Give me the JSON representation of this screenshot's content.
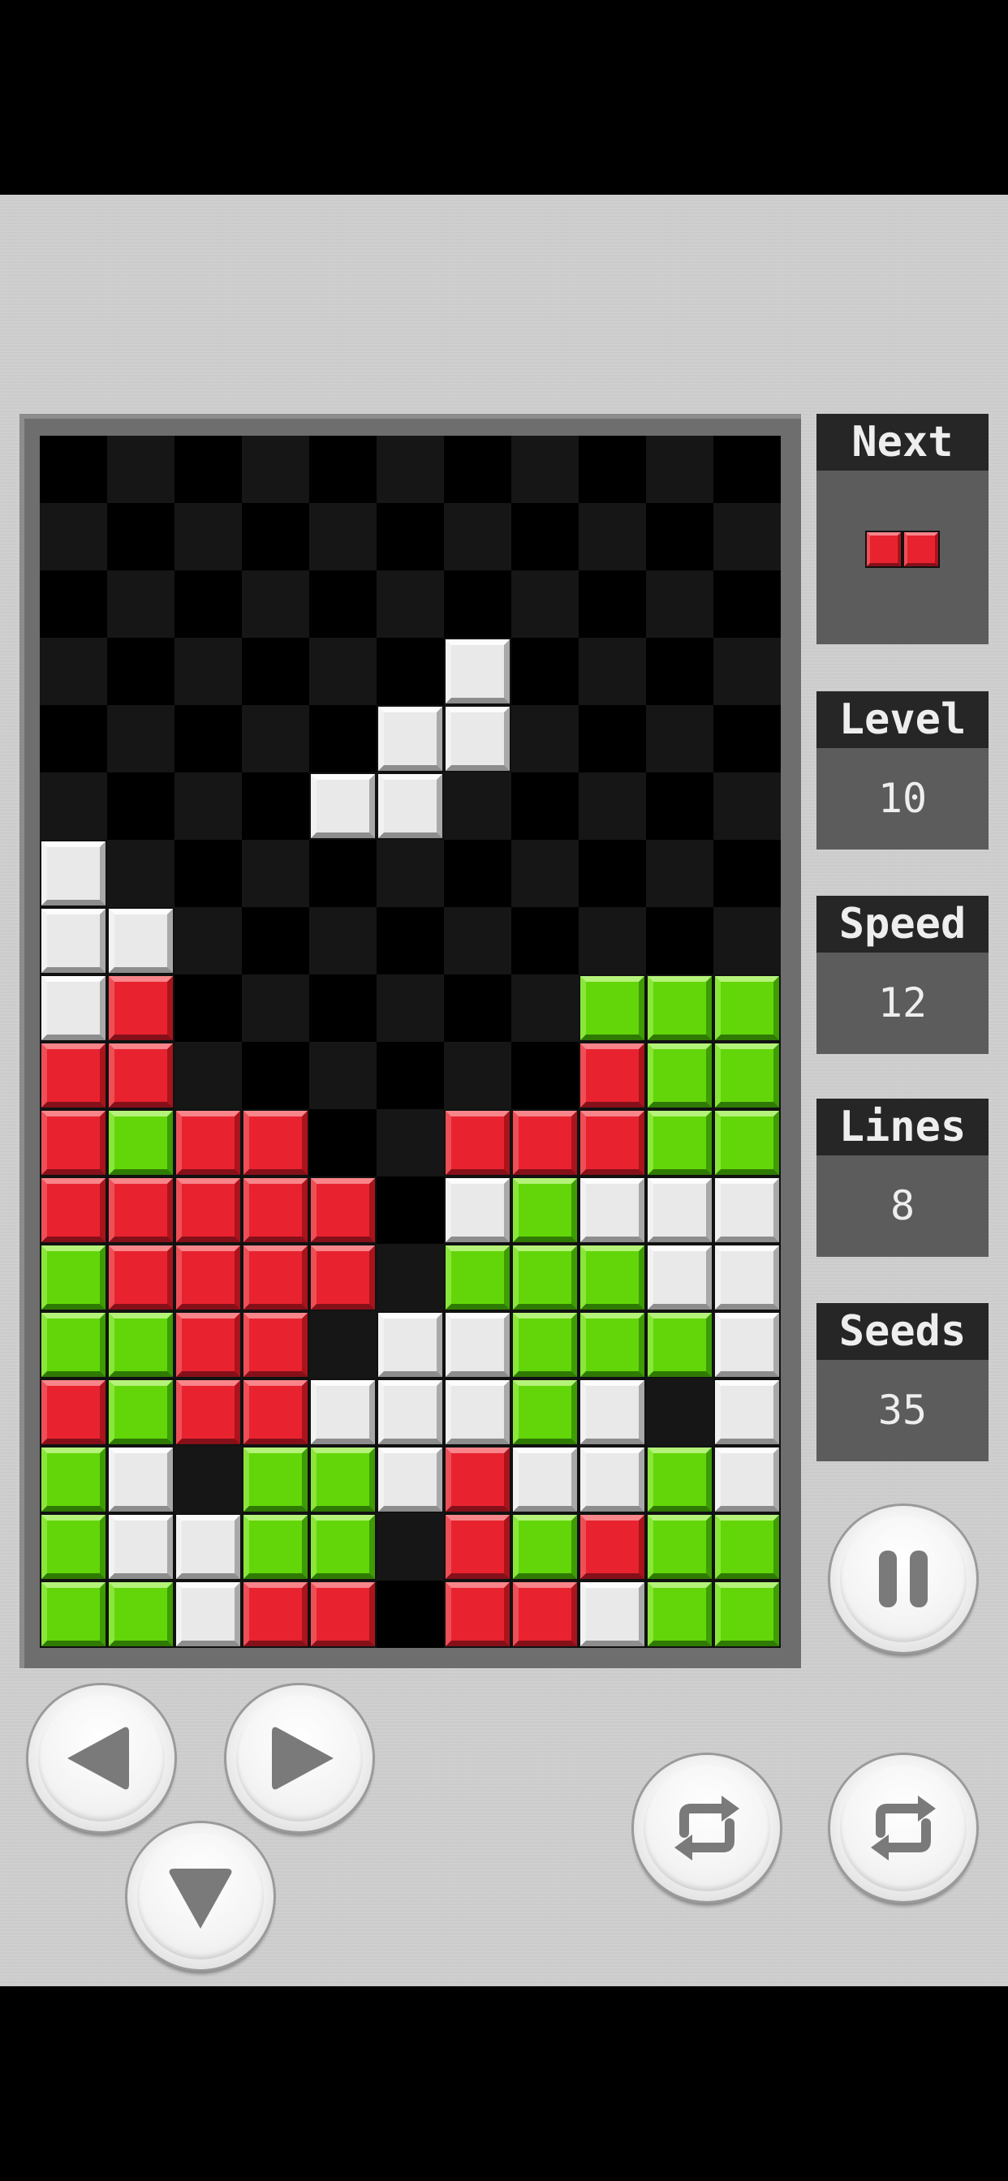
{
  "side": {
    "next_label": "Next",
    "level_label": "Level",
    "level_value": "10",
    "speed_label": "Speed",
    "speed_value": "12",
    "lines_label": "Lines",
    "lines_value": "8",
    "seeds_label": "Seeds",
    "seeds_value": "35"
  },
  "next_piece": [
    "red",
    "red"
  ],
  "colors": {
    "white": "#e9e9e9",
    "red": "#e8232f",
    "green": "#63d609",
    "board_bg_a": "#000000",
    "board_bg_b": "#161616",
    "panel": "#cfcfcf"
  },
  "grid": [
    "...........",
    "...........",
    "...........",
    "......W....",
    ".....WW....",
    "....WW.....",
    "W..........",
    "WW.........",
    "WR......GGG",
    "RR......RGG",
    "RGRR..RRRGG",
    "RRRRR.WGWWW",
    "GRRRR.GGGWW",
    "GGRR.WWGGGW",
    "RGRRWWWGW.W",
    "GW.GGWRWWGW",
    "GWWGG.RGRGG",
    "GGWRR.RRWGG"
  ],
  "icons": {
    "left": "left-arrow-icon",
    "right": "right-arrow-icon",
    "down": "down-arrow-icon",
    "pause": "pause-icon",
    "rotate_ccw": "rotate-ccw-icon",
    "rotate_cw": "rotate-cw-icon"
  }
}
